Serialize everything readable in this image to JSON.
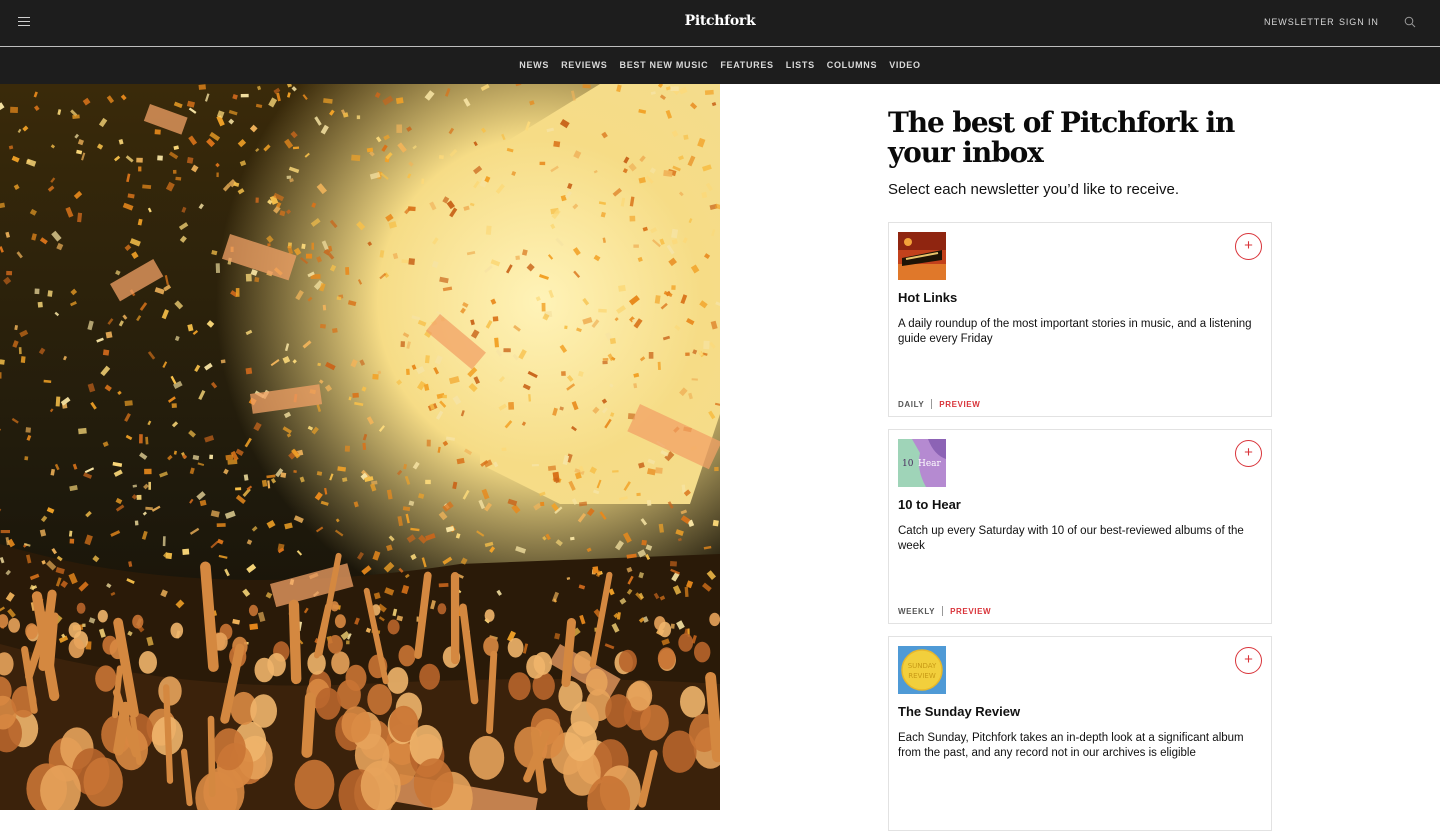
{
  "header": {
    "logo": "Pitchfork",
    "newsletter_link": "NEWSLETTER",
    "signin_link": "SIGN IN"
  },
  "nav": [
    "NEWS",
    "REVIEWS",
    "BEST NEW MUSIC",
    "FEATURES",
    "LISTS",
    "COLUMNS",
    "VIDEO"
  ],
  "page": {
    "title": "The best of Pitchfork in your inbox",
    "subtitle": "Select each newsletter you’d like to receive."
  },
  "newsletters": [
    {
      "title": "Hot Links",
      "description": "A daily roundup of the most important stories in music, and a listening guide every Friday",
      "frequency": "DAILY",
      "preview": "PREVIEW",
      "add": "+"
    },
    {
      "title": "10 to Hear",
      "description": "Catch up every Saturday with 10 of our best-reviewed albums of the week",
      "frequency": "WEEKLY",
      "preview": "PREVIEW",
      "add": "+"
    },
    {
      "title": "The Sunday Review",
      "description": "Each Sunday, Pitchfork takes an in-depth look at a significant album from the past, and any record not in our archives is eligible",
      "frequency": "",
      "preview": "",
      "add": "+"
    }
  ],
  "colors": {
    "header_bg": "#1d1d1d",
    "accent_red": "#d9343a"
  },
  "icons": {
    "menu": "hamburger-icon",
    "search": "search-icon",
    "add": "plus-circle-icon"
  }
}
